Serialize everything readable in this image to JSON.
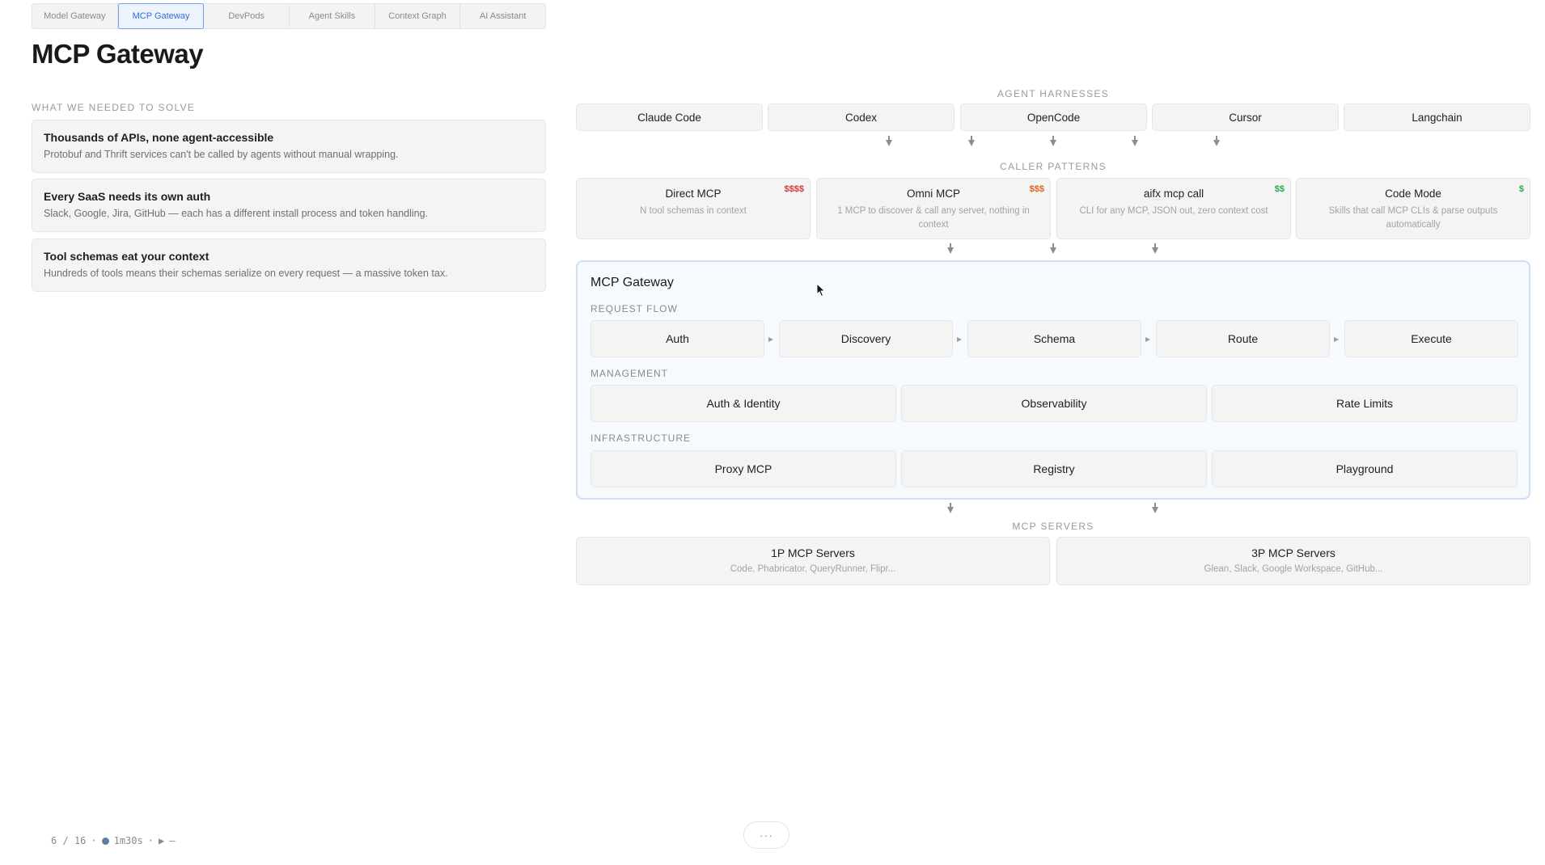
{
  "tabs": [
    {
      "label": "Model Gateway",
      "active": false
    },
    {
      "label": "MCP Gateway",
      "active": true
    },
    {
      "label": "DevPods",
      "active": false
    },
    {
      "label": "Agent Skills",
      "active": false
    },
    {
      "label": "Context Graph",
      "active": false
    },
    {
      "label": "AI Assistant",
      "active": false
    }
  ],
  "page_title": "MCP Gateway",
  "problems": {
    "label": "WHAT WE NEEDED TO SOLVE",
    "items": [
      {
        "title": "Thousands of APIs, none agent-accessible",
        "desc": "Protobuf and Thrift services can't be called by agents without manual wrapping."
      },
      {
        "title": "Every SaaS needs its own auth",
        "desc": "Slack, Google, Jira, GitHub — each has a different install process and token handling."
      },
      {
        "title": "Tool schemas eat your context",
        "desc": "Hundreds of tools means their schemas serialize on every request — a massive token tax."
      }
    ]
  },
  "diagram": {
    "harnesses_label": "AGENT HARNESSES",
    "harnesses": [
      "Claude Code",
      "Codex",
      "OpenCode",
      "Cursor",
      "Langchain"
    ],
    "callers_label": "CALLER PATTERNS",
    "callers": [
      {
        "title": "Direct MCP",
        "desc": "N tool schemas in context",
        "cost": "$$$$",
        "cost_color": "#d23b3b"
      },
      {
        "title": "Omni MCP",
        "desc": "1 MCP to discover & call any server, nothing in context",
        "cost": "$$$",
        "cost_color": "#e0651f"
      },
      {
        "title": "aifx mcp call",
        "desc": "CLI for any MCP, JSON out, zero context cost",
        "cost": "$$",
        "cost_color": "#2fa84f"
      },
      {
        "title": "Code Mode",
        "desc": "Skills that call MCP CLIs & parse outputs automatically",
        "cost": "$",
        "cost_color": "#2fa84f"
      }
    ],
    "gateway": {
      "title": "MCP Gateway",
      "request_flow_label": "REQUEST FLOW",
      "request_flow": [
        "Auth",
        "Discovery",
        "Schema",
        "Route",
        "Execute"
      ],
      "management_label": "MANAGEMENT",
      "management": [
        "Auth & Identity",
        "Observability",
        "Rate Limits"
      ],
      "infrastructure_label": "INFRASTRUCTURE",
      "infrastructure": [
        "Proxy MCP",
        "Registry",
        "Playground"
      ]
    },
    "servers_label": "MCP SERVERS",
    "servers": [
      {
        "title": "1P MCP Servers",
        "desc": "Code, Phabricator, QueryRunner, Flipr..."
      },
      {
        "title": "3P MCP Servers",
        "desc": "Glean, Slack, Google Workspace, GitHub..."
      }
    ]
  },
  "footer": {
    "progress": "6 / 16",
    "separator": "·",
    "duration": "1m30s",
    "play_glyph": "▶",
    "dash": "—",
    "more_label": "···"
  }
}
